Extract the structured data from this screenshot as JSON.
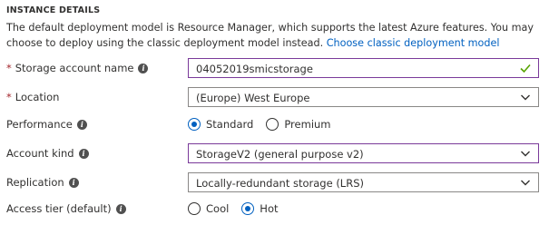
{
  "section_title": "INSTANCE DETAILS",
  "description": {
    "text": "The default deployment model is Resource Manager, which supports the latest Azure features. You may choose to deploy using the classic deployment model instead.",
    "link": "Choose classic deployment model"
  },
  "fields": {
    "storage_account_name": {
      "label": "Storage account name",
      "required": "*",
      "value": "04052019smicstorage",
      "valid_icon": "check-icon"
    },
    "location": {
      "label": "Location",
      "required": "*",
      "value": "(Europe) West Europe"
    },
    "performance": {
      "label": "Performance",
      "options": [
        "Standard",
        "Premium"
      ],
      "selected": "Standard"
    },
    "account_kind": {
      "label": "Account kind",
      "value": "StorageV2 (general purpose v2)"
    },
    "replication": {
      "label": "Replication",
      "value": "Locally-redundant storage (LRS)"
    },
    "access_tier": {
      "label": "Access tier (default)",
      "options": [
        "Cool",
        "Hot"
      ],
      "selected": "Hot"
    }
  },
  "icons": {
    "info": "info-icon",
    "dropdown": "chevron-down-icon",
    "valid": "check-icon"
  },
  "colors": {
    "required": "#a4262c",
    "link": "#0060c0",
    "focus_border": "#7a3a9a",
    "valid": "#57a300"
  }
}
